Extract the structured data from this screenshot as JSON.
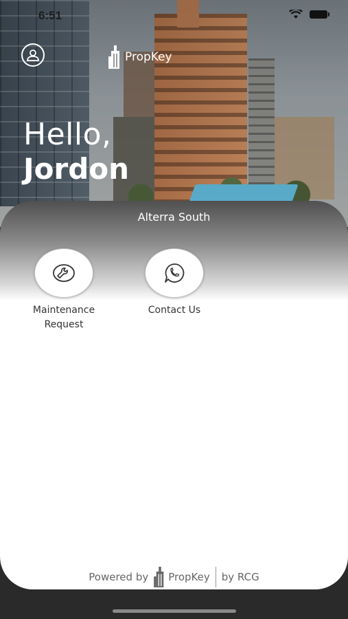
{
  "status_bar": {
    "time": "6:51"
  },
  "header": {
    "brand": "PropKey",
    "greeting": "Hello,",
    "user_name": "Jordon"
  },
  "property": {
    "name": "Alterra South"
  },
  "actions": [
    {
      "label_line1": "Maintenance",
      "label_line2": "Request",
      "icon": "wrench-icon"
    },
    {
      "label_line1": "Contact Us",
      "icon": "whatsapp-phone-icon"
    }
  ],
  "footer": {
    "powered_by": "Powered by",
    "brand": "PropKey",
    "by": "by RCG"
  },
  "colors": {
    "accent": "#ffffff",
    "text": "#333333",
    "pool": "#5fb6d6"
  }
}
